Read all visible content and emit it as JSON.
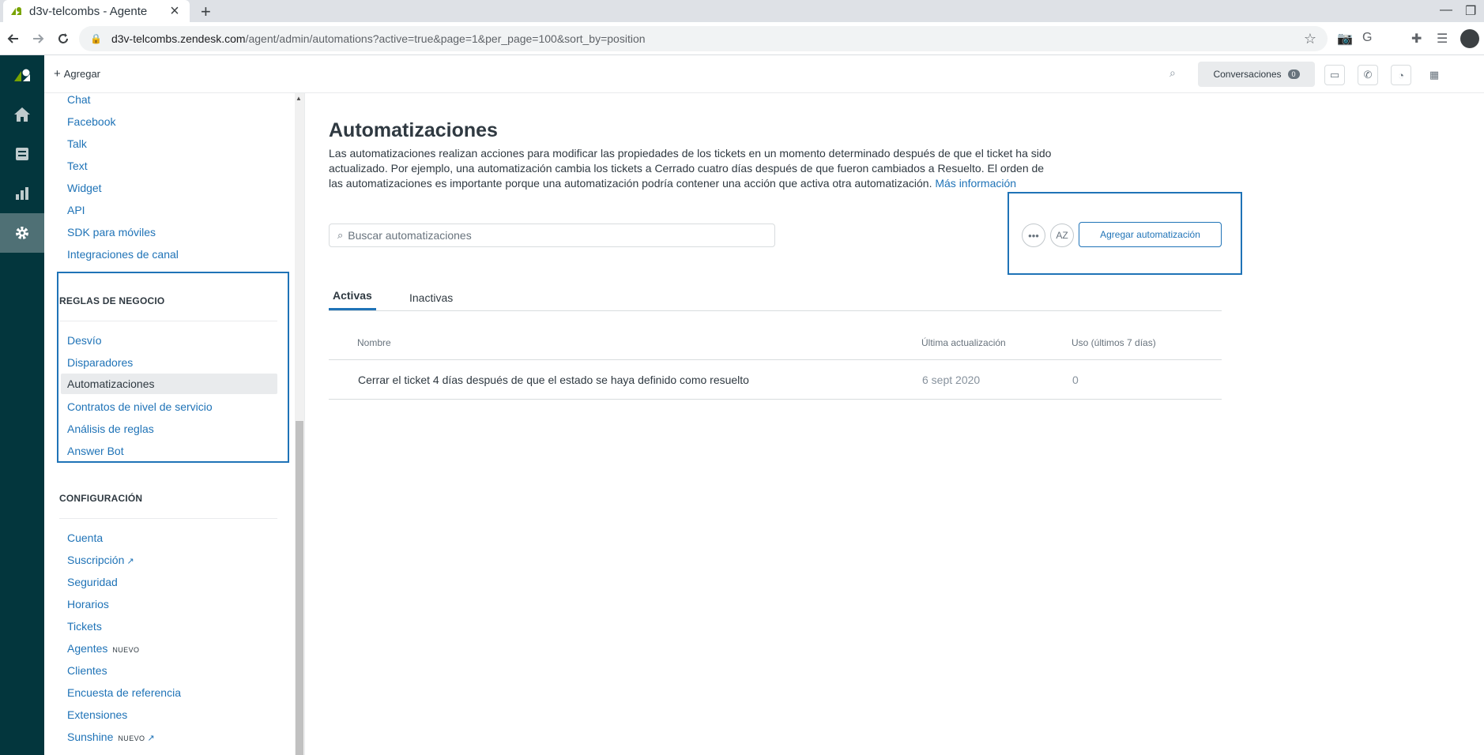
{
  "browser": {
    "tab_title": "d3v-telcombs - Agente",
    "url_host": "d3v-telcombs.zendesk.com",
    "url_path": "/agent/admin/automations?active=true&page=1&per_page=100&sort_by=position",
    "new_tab": "+",
    "close": "×",
    "star": "☆"
  },
  "topbar": {
    "add_label": "Agregar",
    "add_plus": "+",
    "conversations_label": "Conversaciones",
    "conversations_count": "0"
  },
  "sidenav": {
    "channels": [
      "Chat",
      "Facebook",
      "Talk",
      "Text",
      "Widget",
      "API",
      "SDK para móviles",
      "Integraciones de canal"
    ],
    "business_rules_header": "REGLAS DE NEGOCIO",
    "business_rules": [
      "Desvío",
      "Disparadores",
      "Automatizaciones",
      "Contratos de nivel de servicio",
      "Análisis de reglas",
      "Answer Bot"
    ],
    "config_header": "CONFIGURACIÓN",
    "config": [
      "Cuenta",
      "Suscripción",
      "Seguridad",
      "Horarios",
      "Tickets",
      "Agentes",
      "Clientes",
      "Encuesta de referencia",
      "Extensiones",
      "Sunshine"
    ],
    "new_tag": "NUEVO"
  },
  "main": {
    "title": "Automatizaciones",
    "description": "Las automatizaciones realizan acciones para modificar las propiedades de los tickets en un momento determinado después de que el ticket ha sido actualizado. Por ejemplo, una automatización cambia los tickets a Cerrado cuatro días después de que fueron cambiados a Resuelto. El orden de las automatizaciones es importante porque una automatización podría contener una acción que activa otra automatización.",
    "more_info": "Más información",
    "search_placeholder": "Buscar automatizaciones",
    "more_options": "•••",
    "sort_label": "AZ",
    "add_button": "Agregar automatización",
    "tabs": [
      "Activas",
      "Inactivas"
    ],
    "columns": [
      "Nombre",
      "Última actualización",
      "Uso (últimos 7 días)"
    ],
    "rows": [
      {
        "name": "Cerrar el ticket 4 días después de que el estado se haya definido como resuelto",
        "updated": "6 sept 2020",
        "usage": "0"
      }
    ]
  },
  "colors": {
    "rail": "#03363d",
    "accent": "#1f73b7",
    "zendesk_green": "#78a300"
  }
}
